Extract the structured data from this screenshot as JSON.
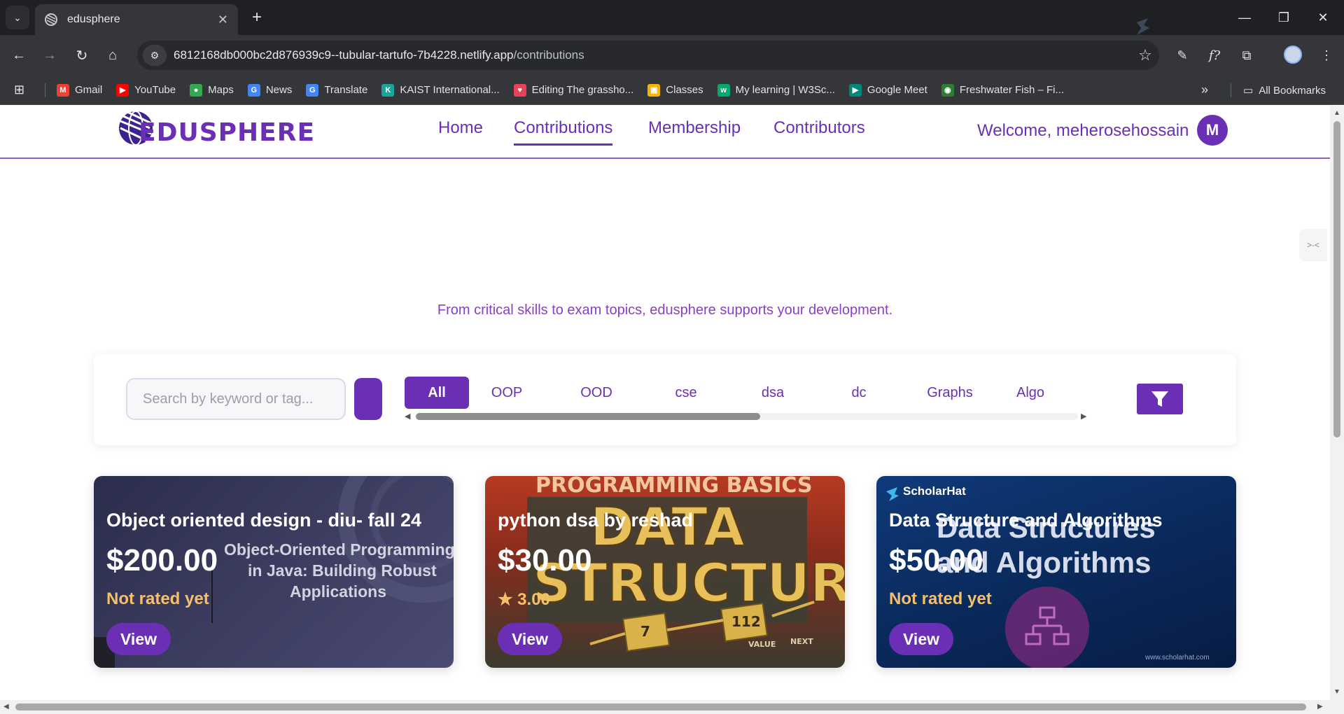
{
  "browser": {
    "tab": {
      "title": "edusphere",
      "close_glyph": "✕"
    },
    "new_tab_glyph": "+",
    "window": {
      "minimize": "—",
      "restore": "❐",
      "close": "✕"
    },
    "nav": {
      "back": "←",
      "forward": "→",
      "reload": "↻",
      "home": "⌂"
    },
    "url": {
      "host": "6812168db000bc2d876939c9--tubular-tartufo-7b4228.netlify.app",
      "path": "/contributions"
    },
    "bookmark_star": "☆",
    "bookmarks": [
      {
        "label": "Gmail",
        "icon": "gmail-icon",
        "color": "#ea4335",
        "glyph": "M"
      },
      {
        "label": "YouTube",
        "icon": "youtube-icon",
        "color": "#ff0000",
        "glyph": "▶"
      },
      {
        "label": "Maps",
        "icon": "maps-icon",
        "color": "#34a853",
        "glyph": "●"
      },
      {
        "label": "News",
        "icon": "news-icon",
        "color": "#4285f4",
        "glyph": "G"
      },
      {
        "label": "Translate",
        "icon": "translate-icon",
        "color": "#4285f4",
        "glyph": "G"
      },
      {
        "label": "KAIST International...",
        "icon": "kaist-icon",
        "color": "#1aa59a",
        "glyph": "K"
      },
      {
        "label": "Editing The grassho...",
        "icon": "heart-icon",
        "color": "#e8425a",
        "glyph": "♥"
      },
      {
        "label": "Classes",
        "icon": "classroom-icon",
        "color": "#f4b400",
        "glyph": "▣"
      },
      {
        "label": "My learning | W3Sc...",
        "icon": "w3schools-icon",
        "color": "#04aa6d",
        "glyph": "w"
      },
      {
        "label": "Google Meet",
        "icon": "meet-icon",
        "color": "#00897b",
        "glyph": "▶"
      },
      {
        "label": "Freshwater Fish – Fi...",
        "icon": "fish-icon",
        "color": "#2e7d32",
        "glyph": "◉"
      }
    ],
    "bookmarks_more": "»",
    "all_bookmarks": "All Bookmarks"
  },
  "site": {
    "logo_text": "EDUSPHERE",
    "nav": [
      {
        "label": "Home",
        "active": false
      },
      {
        "label": "Contributions",
        "active": true
      },
      {
        "label": "Membership",
        "active": false
      },
      {
        "label": "Contributors",
        "active": false
      }
    ],
    "welcome": "Welcome, meherosehossain",
    "avatar_initial": "M",
    "side_widget_glyph": ">-<",
    "brand_color": "#6b2fb5"
  },
  "tagline": "From critical skills to exam topics, edusphere supports your development.",
  "filters": {
    "search_placeholder": "Search by keyword or tag...",
    "chips": [
      "All",
      "OOP",
      "OOD",
      "cse",
      "dsa",
      "dc",
      "Graphs",
      "Algo"
    ],
    "active_chip": "All",
    "chip_scroll_fraction": 0.52
  },
  "cards": [
    {
      "title": "Object oriented design - diu- fall 24",
      "price": "$200.00",
      "rating": "Not rated yet",
      "view_label": "View",
      "thumb_lines": [
        "Object-Oriented Programming",
        "in Java: Building Robust",
        "Applications"
      ]
    },
    {
      "title": "python dsa by reshad",
      "price": "$30.00",
      "rating": "★ 3.00",
      "view_label": "View",
      "thumb_lines": [
        "PROGRAMMING BASICS",
        "DATA",
        "STRUCTURES",
        "7",
        "112",
        "VALUE",
        "NEXT"
      ]
    },
    {
      "title": "Data Structure and Algorithms",
      "price": "$50.00",
      "rating": "Not rated yet",
      "view_label": "View",
      "thumb_lines": [
        "ScholarHat",
        "Data Structures",
        "and Algorithms",
        "www.scholarhat.com"
      ]
    }
  ]
}
